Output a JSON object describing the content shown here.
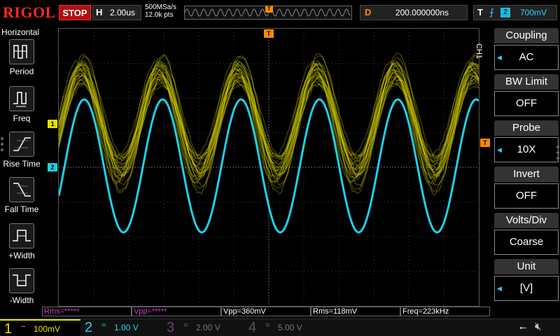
{
  "topbar": {
    "logo": "RIGOL",
    "run_state": "STOP",
    "h_label": "H",
    "timebase": "2.00us",
    "sample_rate": "500MSa/s",
    "memory_depth": "12.0k pts",
    "trigger_marker": "T",
    "delay_label": "D",
    "delay_value": "200.000000ns",
    "trig_label": "T",
    "trig_edge": "rising-edge-icon",
    "trig_source": "2",
    "trig_level": "700mV"
  },
  "left_panel": {
    "title": "Horizontal",
    "items": [
      {
        "label": "Period",
        "icon": "period-icon"
      },
      {
        "label": "Freq",
        "icon": "freq-icon"
      },
      {
        "label": "Rise Time",
        "icon": "rise-time-icon"
      },
      {
        "label": "Fall Time",
        "icon": "fall-time-icon"
      },
      {
        "label": "+Width",
        "icon": "pos-width-icon"
      },
      {
        "label": "-Width",
        "icon": "neg-width-icon"
      }
    ]
  },
  "screen": {
    "ch1_marker": "1",
    "ch2_marker": "2",
    "trigger_top_marker": "T",
    "trigger_level_marker": "T"
  },
  "right_panel": {
    "tab": "CH1",
    "items": [
      {
        "title": "Coupling",
        "value": "AC"
      },
      {
        "title": "BW Limit",
        "value": "OFF"
      },
      {
        "title": "Probe",
        "value": "10X"
      },
      {
        "title": "Invert",
        "value": "OFF"
      },
      {
        "title": "Volts/Div",
        "value": "Coarse"
      },
      {
        "title": "Unit",
        "value": "[V]"
      }
    ]
  },
  "measurements": [
    {
      "text": "Rms=*****"
    },
    {
      "text": "Vpp=*****"
    },
    {
      "text": "Vpp=360mV"
    },
    {
      "text": "Rms=118mV"
    },
    {
      "text": "Freq=223kHz"
    }
  ],
  "channels": [
    {
      "num": "1",
      "coupling": "~",
      "vdiv": "100mV",
      "color": "#e8e000"
    },
    {
      "num": "2",
      "coupling": "=",
      "vdiv": "1.00 V",
      "color": "#1fd0e8"
    },
    {
      "num": "3",
      "coupling": "=",
      "vdiv": "2.00 V",
      "color": "#b040b0"
    },
    {
      "num": "4",
      "coupling": "=",
      "vdiv": "5.00 V",
      "color": "#4060e0"
    }
  ],
  "colors": {
    "ch1": "#e8e000",
    "ch2": "#1fd0e8",
    "brand": "#ff2a1a",
    "trigger": "#ff8a00"
  },
  "status_icons": [
    "usb-icon",
    "speaker-muted-icon"
  ]
}
